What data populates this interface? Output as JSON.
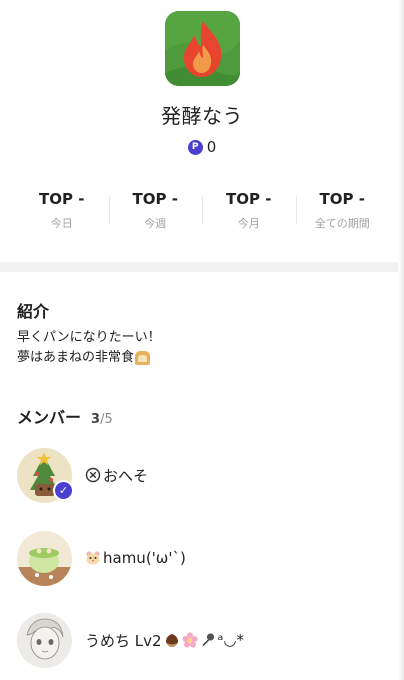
{
  "group": {
    "name": "発酵なう",
    "points": "0",
    "points_badge": "P",
    "icon": "flame-app-icon"
  },
  "ranks": [
    {
      "value": "TOP -",
      "label": "今日"
    },
    {
      "value": "TOP -",
      "label": "今週"
    },
    {
      "value": "TOP -",
      "label": "今月"
    },
    {
      "value": "TOP -",
      "label": "全ての期間"
    }
  ],
  "intro": {
    "title": "紹介",
    "line1": "早くパンになりたーい！",
    "line2": "夢はあまねの非常食"
  },
  "members": {
    "title": "メンバー",
    "count": "3",
    "total": "/5",
    "items": [
      {
        "name": "おへそ",
        "prefix_icon": "circled-x-icon",
        "verified": true
      },
      {
        "name": "hamu('ω'`)",
        "prefix_icon": "hamster-icon",
        "verified": false
      },
      {
        "name": "うめち Lv2",
        "suffix": "ᵃ◡*",
        "suffix_icons": [
          "chestnut-icon",
          "cherry-blossom-icon",
          "microphone-icon"
        ],
        "verified": false
      }
    ]
  },
  "colors": {
    "accent": "#4a3fd0",
    "icon_green": "#4f9a3c",
    "flame": "#e8452f",
    "separator": "#f1f1f1"
  }
}
